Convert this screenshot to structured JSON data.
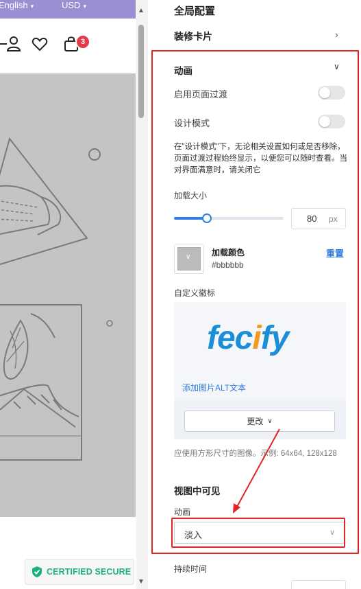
{
  "preview": {
    "topbar": {
      "language": "English",
      "currency": "USD"
    },
    "cart_count": "3",
    "certified": "CERTIFIED SECURE"
  },
  "panel": {
    "title": "全局配置",
    "decor_card": "装修卡片",
    "animation_section": "动画",
    "page_transition_label": "启用页面过渡",
    "page_transition_on": false,
    "design_mode_label": "设计模式",
    "design_mode_on": false,
    "design_mode_desc": "在\"设计模式\"下，无论相关设置如何或是否移除，页面过渡过程始终显示，以便您可以随时查看。当对界面满意时，请关闭它",
    "loader_size_label": "加载大小",
    "loader_size_value": "80",
    "loader_size_unit": "px",
    "loader_size_fraction": 0.3,
    "loader_color_label": "加载颜色",
    "loader_color_hex": "#bbbbbb",
    "reset_label": "重置",
    "custom_logo_label": "自定义徽标",
    "logo_text_a": "fec",
    "logo_text_b": "i",
    "logo_text_c": "fy",
    "alt_text_link": "添加图片ALT文本",
    "change_button": "更改",
    "size_hint": "应使用方形尺寸的图像。示例: 64x64, 128x128",
    "visible_in_view": "视图中可见",
    "anim_label": "动画",
    "anim_value": "淡入",
    "duration_label": "持续时间"
  },
  "colors": {
    "accent": "#2f7de1",
    "highlight": "#e02424",
    "topbar": "#9b8fd4"
  }
}
